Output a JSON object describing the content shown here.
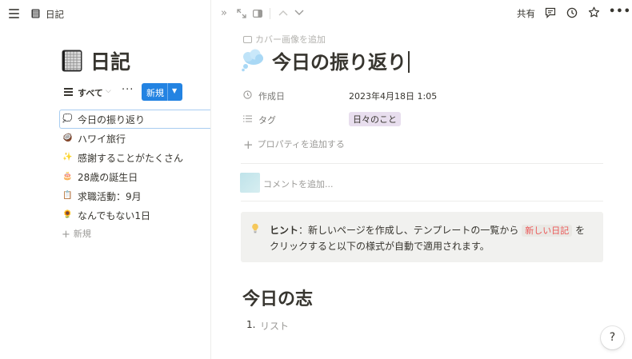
{
  "sidebar_pane": {
    "breadcrumb": "日記",
    "database_title": "日記",
    "view": {
      "label": "すべて",
      "more": "···",
      "new_button": "新規"
    },
    "items": [
      {
        "emoji": "💭",
        "title": "今日の振り返り",
        "selected": true
      },
      {
        "emoji": "🥥",
        "title": "ハワイ旅行",
        "selected": false
      },
      {
        "emoji": "✨",
        "title": "感謝することがたくさん",
        "selected": false
      },
      {
        "emoji": "🎂",
        "title": "28歳の誕生日",
        "selected": false
      },
      {
        "emoji": "📋",
        "title": "求職活動：9月",
        "selected": false
      },
      {
        "emoji": "🌻",
        "title": "なんでもない1日",
        "selected": false
      }
    ],
    "add_new": "新規"
  },
  "page": {
    "toolbar": {
      "share": "共有"
    },
    "add_cover": "カバー画像を追加",
    "emoji": "💭",
    "title": "今日の振り返り",
    "properties": {
      "created": {
        "name": "作成日",
        "value": "2023年4月18日 1:05"
      },
      "tags": {
        "name": "タグ",
        "value": "日々のこと",
        "tag_color": "#e8deee"
      }
    },
    "add_property": "プロパティを追加する",
    "comment_placeholder": "コメントを追加...",
    "callout": {
      "icon": "lightbulb-icon",
      "hint_label": "ヒント",
      "text_before": "：新しいページを作成し、テンプレートの一覧から",
      "code": "新しい日記",
      "text_after": "を",
      "line2": "クリックすると以下の様式が自動で適用されます。"
    },
    "heading": "今日の志",
    "list_number": "1.",
    "list_placeholder": "リスト",
    "help": "?"
  },
  "colors": {
    "accent": "#2383e2",
    "text": "#37352f",
    "muted": "#9b9a97",
    "callout_bg": "#f1f1ef",
    "code_red": "#eb5757"
  }
}
